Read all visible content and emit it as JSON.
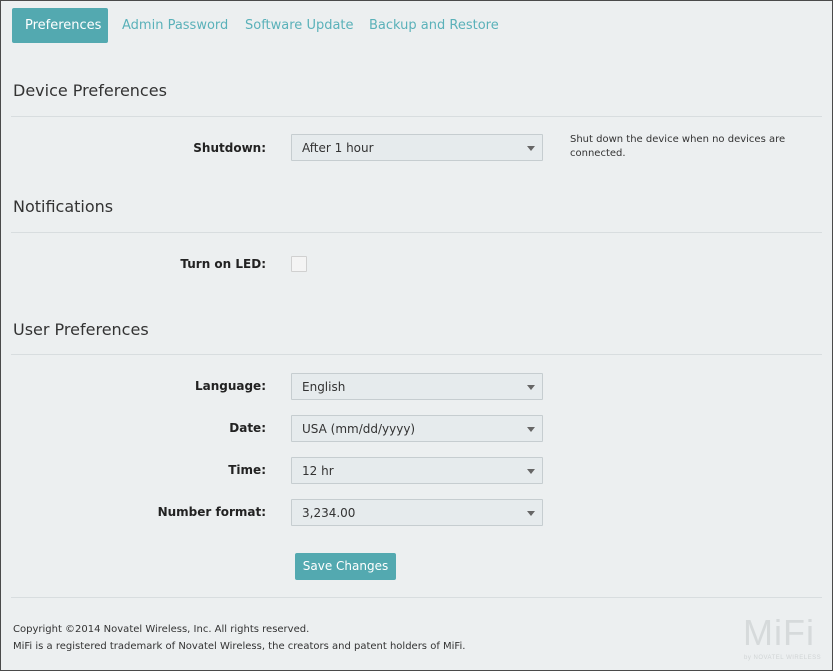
{
  "tabs": [
    {
      "label": "Preferences",
      "active": true
    },
    {
      "label": "Admin Password",
      "active": false
    },
    {
      "label": "Software Update",
      "active": false
    },
    {
      "label": "Backup and Restore",
      "active": false
    }
  ],
  "device_preferences": {
    "title": "Device Preferences",
    "shutdown": {
      "label": "Shutdown:",
      "value": "After 1 hour",
      "help": "Shut down the device when no devices are connected."
    }
  },
  "notifications": {
    "title": "Notifications",
    "led": {
      "label": "Turn on LED:",
      "checked": false
    }
  },
  "user_preferences": {
    "title": "User Preferences",
    "language": {
      "label": "Language:",
      "value": "English"
    },
    "date": {
      "label": "Date:",
      "value": "USA (mm/dd/yyyy)"
    },
    "time": {
      "label": "Time:",
      "value": "12 hr"
    },
    "number_format": {
      "label": "Number format:",
      "value": "3,234.00"
    }
  },
  "save_label": "Save Changes",
  "footer": {
    "copyright": "Copyright ©2014 Novatel Wireless, Inc. All rights reserved.",
    "trademark": "MiFi is a registered trademark of Novatel Wireless, the creators and patent holders of MiFi.",
    "logo_text": "MiFi",
    "logo_sub": "by NOVATEL WIRELESS"
  },
  "colors": {
    "accent": "#53a9b0",
    "tab_text": "#5ab1b9",
    "background": "#eceff0"
  }
}
